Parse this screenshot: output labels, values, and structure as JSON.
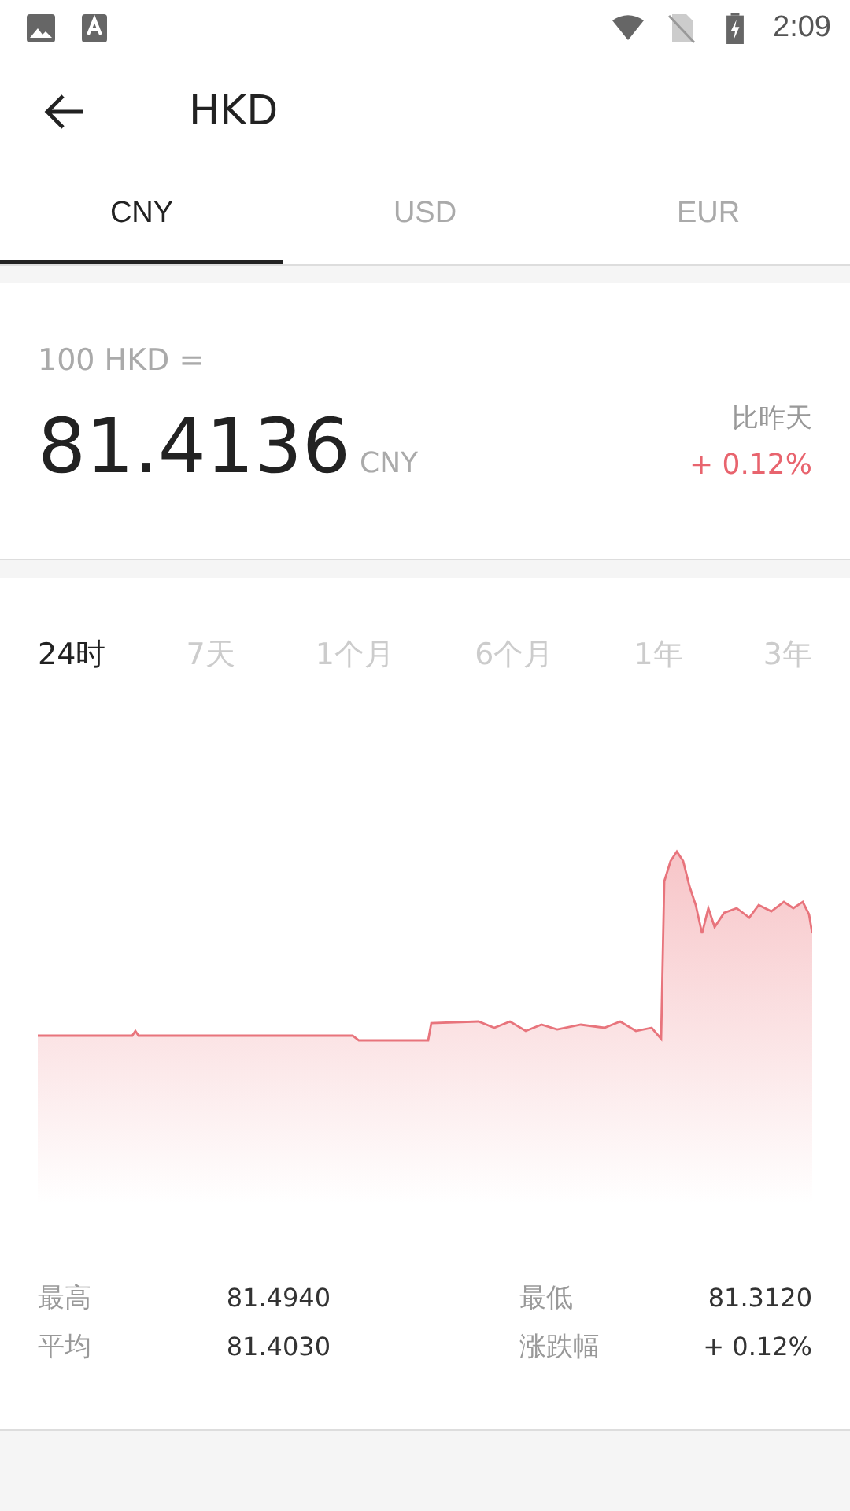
{
  "status_bar": {
    "time": "2:09"
  },
  "header": {
    "title": "HKD"
  },
  "tabs": [
    {
      "label": "CNY",
      "selected": true
    },
    {
      "label": "USD",
      "selected": false
    },
    {
      "label": "EUR",
      "selected": false
    }
  ],
  "rate": {
    "base": "100  HKD =",
    "value": "81.4136",
    "unit": "CNY",
    "compare_label": "比昨天",
    "change": "+ 0.12%"
  },
  "periods": [
    {
      "label": "24时",
      "selected": true
    },
    {
      "label": "7天",
      "selected": false
    },
    {
      "label": "1个月",
      "selected": false
    },
    {
      "label": "6个月",
      "selected": false
    },
    {
      "label": "1年",
      "selected": false
    },
    {
      "label": "3年",
      "selected": false
    }
  ],
  "stats": [
    {
      "label": "最高",
      "value": "81.4940"
    },
    {
      "label": "最低",
      "value": "81.3120"
    },
    {
      "label": "平均",
      "value": "81.4030"
    },
    {
      "label": "涨跌幅",
      "value": "+ 0.12%"
    }
  ]
}
